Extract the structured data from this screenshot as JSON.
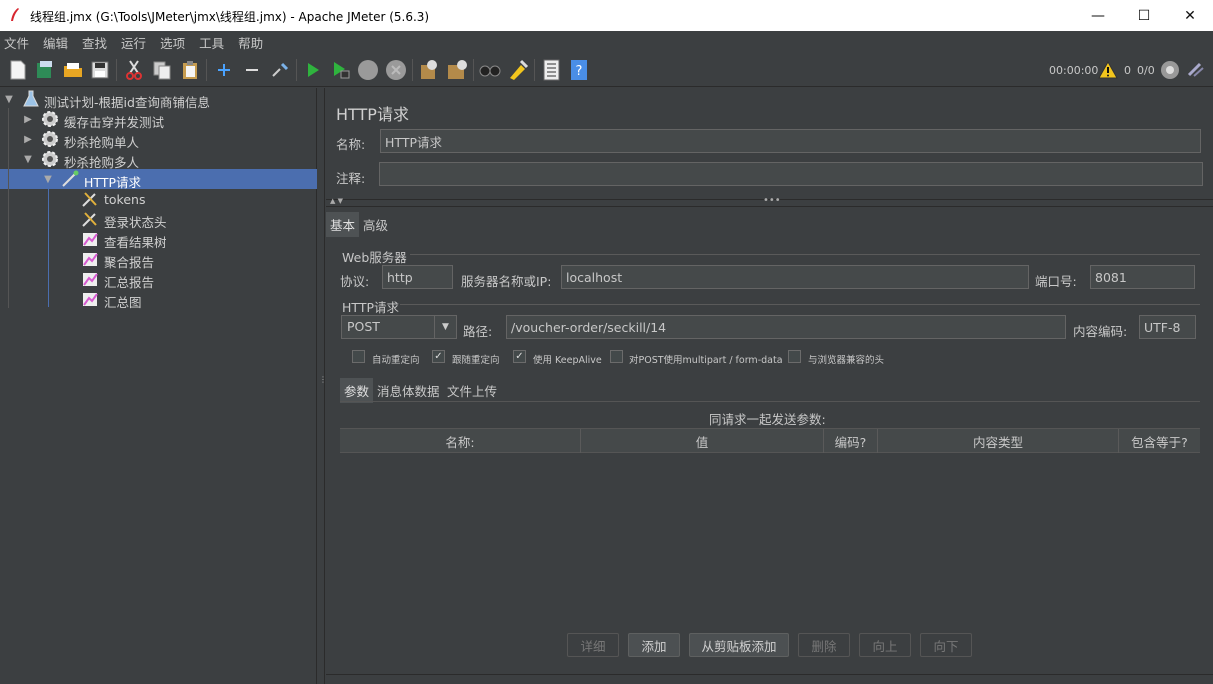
{
  "window": {
    "title": "线程组.jmx (G:\\Tools\\JMeter\\jmx\\线程组.jmx) - Apache JMeter (5.6.3)",
    "minimize": "—",
    "maximize": "☐",
    "close": "✕"
  },
  "menu": [
    "文件",
    "编辑",
    "查找",
    "运行",
    "选项",
    "工具",
    "帮助"
  ],
  "toolbar": {
    "elapsed": "00:00:00",
    "warnings": "0",
    "threads": "0/0"
  },
  "tree": {
    "items": [
      {
        "label": "测试计划-根据id查询商铺信息",
        "icon": "flask-icon",
        "expanded": true
      },
      {
        "label": "缓存击穿并发测试",
        "icon": "gear-icon",
        "expanded": false
      },
      {
        "label": "秒杀抢购单人",
        "icon": "gear-icon",
        "expanded": false
      },
      {
        "label": "秒杀抢购多人",
        "icon": "gear-icon",
        "expanded": true
      },
      {
        "label": "HTTP请求",
        "icon": "sampler-icon",
        "expanded": true,
        "selected": true
      },
      {
        "label": "tokens",
        "icon": "wrench-icon"
      },
      {
        "label": "登录状态头",
        "icon": "wrench-icon"
      },
      {
        "label": "查看结果树",
        "icon": "chart-icon"
      },
      {
        "label": "聚合报告",
        "icon": "chart-icon"
      },
      {
        "label": "汇总报告",
        "icon": "chart-icon"
      },
      {
        "label": "汇总图",
        "icon": "chart-icon"
      }
    ]
  },
  "panel": {
    "title": "HTTP请求",
    "name_label": "名称:",
    "name_value": "HTTP请求",
    "comment_label": "注释:",
    "comment_value": "",
    "tabs": [
      "基本",
      "高级"
    ],
    "web_server": {
      "group_title": "Web服务器",
      "protocol_label": "协议:",
      "protocol_value": "http",
      "server_label": "服务器名称或IP:",
      "server_value": "localhost",
      "port_label": "端口号:",
      "port_value": "8081"
    },
    "http_request": {
      "group_title": "HTTP请求",
      "method": "POST",
      "path_label": "路径:",
      "path_value": "/voucher-order/seckill/14",
      "encoding_label": "内容编码:",
      "encoding_value": "UTF-8"
    },
    "options": [
      {
        "label": "自动重定向",
        "checked": false
      },
      {
        "label": "跟随重定向",
        "checked": true
      },
      {
        "label": "使用 KeepAlive",
        "checked": true
      },
      {
        "label": "对POST使用multipart / form-data",
        "checked": false
      },
      {
        "label": "与浏览器兼容的头",
        "checked": false
      }
    ],
    "sub_tabs": [
      "参数",
      "消息体数据",
      "文件上传"
    ],
    "params_caption": "同请求一起发送参数:",
    "columns": [
      "名称:",
      "值",
      "编码?",
      "内容类型",
      "包含等于?"
    ],
    "buttons": [
      {
        "label": "详细",
        "enabled": false
      },
      {
        "label": "添加",
        "enabled": true
      },
      {
        "label": "从剪贴板添加",
        "enabled": true
      },
      {
        "label": "删除",
        "enabled": false
      },
      {
        "label": "向上",
        "enabled": false
      },
      {
        "label": "向下",
        "enabled": false
      }
    ]
  }
}
